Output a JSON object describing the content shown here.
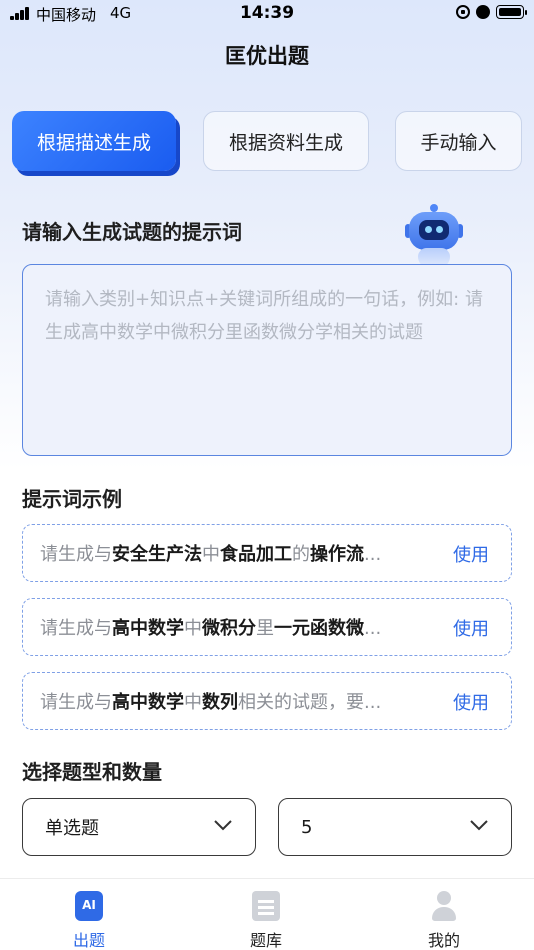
{
  "status_bar": {
    "carrier": "中国移动",
    "network": "4G",
    "time": "14:39"
  },
  "app": {
    "title": "匡优出题"
  },
  "tabs": [
    {
      "label": "根据描述生成",
      "active": true
    },
    {
      "label": "根据资料生成",
      "active": false
    },
    {
      "label": "手动输入",
      "active": false
    }
  ],
  "prompt": {
    "title": "请输入生成试题的提示词",
    "placeholder": "请输入类别+知识点+关键词所组成的一句话，例如: 请生成高中数学中微积分里函数微分学相关的试题"
  },
  "examples": {
    "title": "提示词示例",
    "use_label": "使用",
    "items": [
      {
        "segments": [
          {
            "t": "请生成与",
            "b": false
          },
          {
            "t": "安全生产法",
            "b": true
          },
          {
            "t": "中",
            "b": false
          },
          {
            "t": "食品加工",
            "b": true
          },
          {
            "t": "的",
            "b": false
          },
          {
            "t": "操作流",
            "b": true
          },
          {
            "t": "...",
            "b": false
          }
        ]
      },
      {
        "segments": [
          {
            "t": "请生成与",
            "b": false
          },
          {
            "t": "高中数学",
            "b": true
          },
          {
            "t": "中",
            "b": false
          },
          {
            "t": "微积分",
            "b": true
          },
          {
            "t": "里",
            "b": false
          },
          {
            "t": "一元函数微",
            "b": true
          },
          {
            "t": "...",
            "b": false
          }
        ]
      },
      {
        "segments": [
          {
            "t": "请生成与",
            "b": false
          },
          {
            "t": "高中数学",
            "b": true
          },
          {
            "t": "中",
            "b": false
          },
          {
            "t": "数列",
            "b": true
          },
          {
            "t": "相关的试题，要...",
            "b": false
          }
        ]
      }
    ]
  },
  "question_settings": {
    "title": "选择题型和数量",
    "type_value": "单选题",
    "count_value": "5"
  },
  "bottom_nav": {
    "items": [
      {
        "label": "出题",
        "icon": "ai-icon",
        "active": true,
        "icon_text": "AI"
      },
      {
        "label": "题库",
        "icon": "question-bank-icon",
        "active": false
      },
      {
        "label": "我的",
        "icon": "profile-icon",
        "active": false
      }
    ]
  },
  "colors": {
    "accent": "#2f6ae6",
    "tab_active": "#1a5cf0",
    "dashed_border": "#7fa0e6"
  }
}
